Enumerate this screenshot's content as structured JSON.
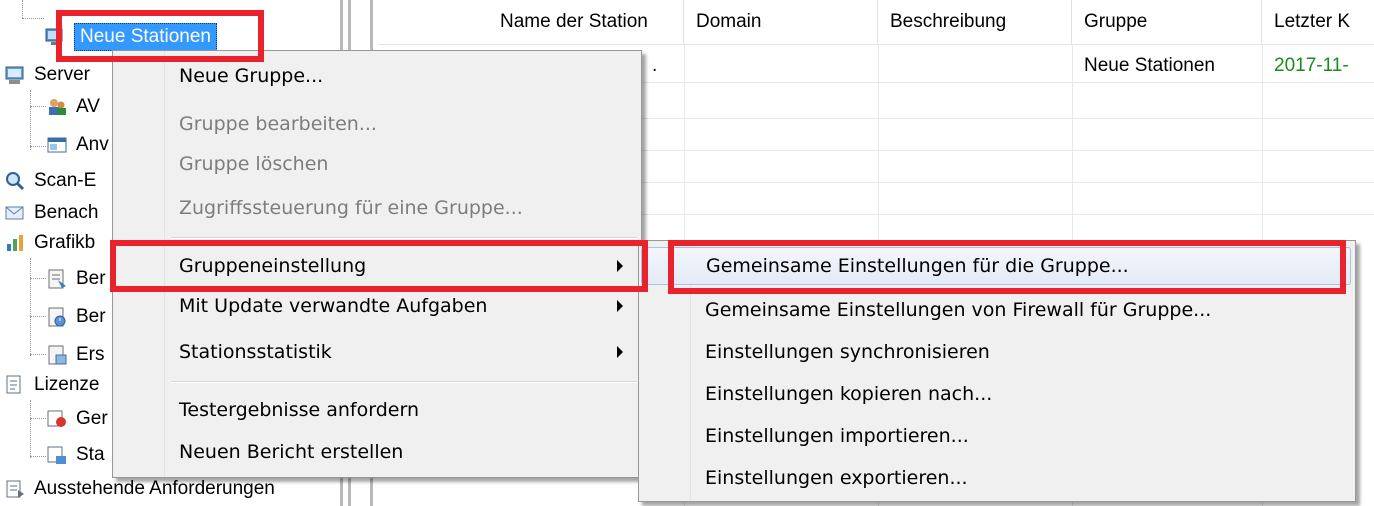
{
  "tree": {
    "items": [
      {
        "label": "Neue Stationen",
        "icon": "computer-group-icon"
      },
      {
        "label": "Server",
        "icon": "server-icon"
      },
      {
        "label": "AV",
        "icon": "admin-users-icon"
      },
      {
        "label": "Anv",
        "icon": "window-app-icon"
      },
      {
        "label": "Scan-E",
        "icon": "scan-magnifier-icon"
      },
      {
        "label": "Benach",
        "icon": "notification-icon"
      },
      {
        "label": "Grafikb",
        "icon": "chart-icon"
      },
      {
        "label": "Ber",
        "icon": "report-icon"
      },
      {
        "label": "Ber",
        "icon": "report-schedule-icon"
      },
      {
        "label": "Ers",
        "icon": "report-create-icon"
      },
      {
        "label": "Lizenze",
        "icon": "license-icon"
      },
      {
        "label": "Ger",
        "icon": "license-devices-icon"
      },
      {
        "label": "Sta",
        "icon": "license-stations-icon"
      },
      {
        "label": "Ausstehende Anforderungen",
        "icon": "pending-requests-icon"
      }
    ]
  },
  "table": {
    "columns": [
      "Name der Station",
      "Domain",
      "Beschreibung",
      "Gruppe",
      "Letzter K"
    ],
    "rows": [
      {
        "name": ".",
        "domain": "",
        "description": "",
        "group": "Neue Stationen",
        "last": "2017-11-"
      }
    ],
    "date_color": "#1a8c1a"
  },
  "context_menu": {
    "items": [
      {
        "label": "Neue Gruppe...",
        "enabled": true
      },
      {
        "label": "Gruppe bearbeiten...",
        "enabled": false
      },
      {
        "label": "Gruppe löschen",
        "enabled": false
      },
      {
        "label": "Zugriffssteuerung für eine Gruppe...",
        "enabled": false
      },
      {
        "label": "Gruppeneinstellung",
        "enabled": true,
        "submenu": true
      },
      {
        "label": "Mit Update verwandte Aufgaben",
        "enabled": true,
        "submenu": true
      },
      {
        "label": "Stationsstatistik",
        "enabled": true,
        "submenu": true
      },
      {
        "label": "Testergebnisse anfordern",
        "enabled": true
      },
      {
        "label": "Neuen Bericht erstellen",
        "enabled": true
      }
    ]
  },
  "submenu": {
    "items": [
      {
        "label": "Gemeinsame Einstellungen für die Gruppe...",
        "highlighted": true
      },
      {
        "label": "Gemeinsame Einstellungen von Firewall für Gruppe..."
      },
      {
        "label": "Einstellungen synchronisieren"
      },
      {
        "label": "Einstellungen kopieren nach..."
      },
      {
        "label": "Einstellungen importieren..."
      },
      {
        "label": "Einstellungen exportieren..."
      }
    ]
  },
  "colors": {
    "selection": "#3399ff",
    "annotation_red": "#e8232b",
    "menu_bg": "#f0f0f0"
  }
}
